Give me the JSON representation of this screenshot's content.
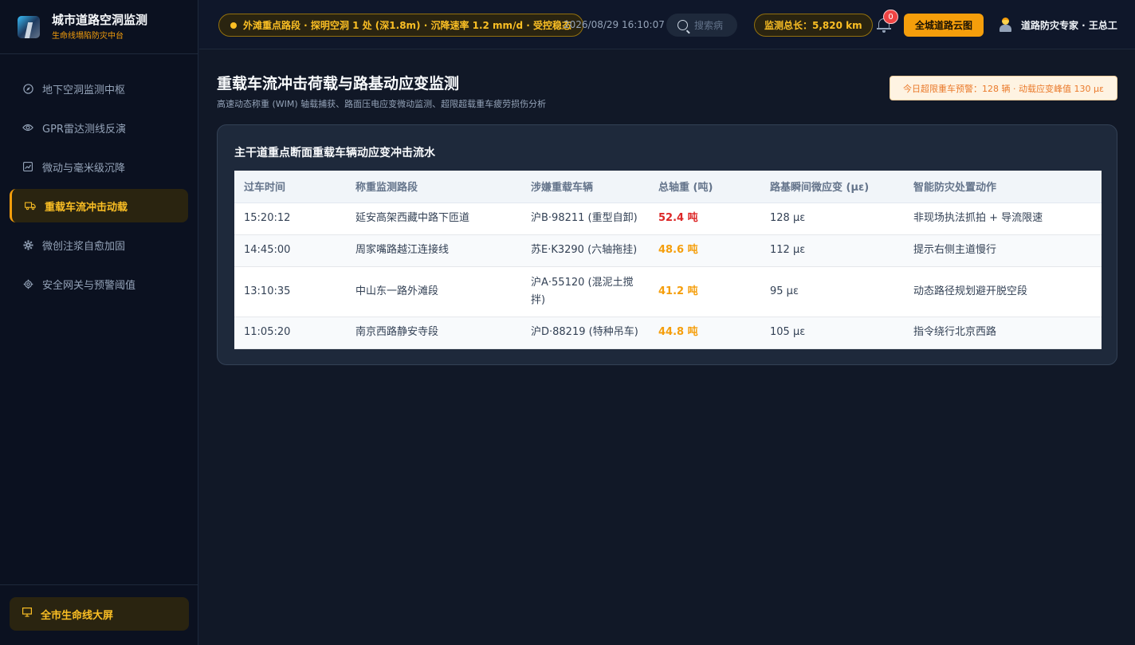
{
  "brand": {
    "title": "城市道路空洞监测",
    "subtitle": "生命线塌陷防灾中台"
  },
  "sidebar": {
    "items": [
      {
        "label": "地下空洞监测中枢",
        "icon": "compass-icon"
      },
      {
        "label": "GPR雷达测线反演",
        "icon": "eye-icon"
      },
      {
        "label": "微动与毫米级沉降",
        "icon": "chart-icon"
      },
      {
        "label": "重载车流冲击动载",
        "icon": "truck-icon",
        "active": true
      },
      {
        "label": "微创注浆自愈加固",
        "icon": "gear-icon"
      },
      {
        "label": "安全网关与预警阈值",
        "icon": "cog-icon"
      }
    ],
    "bottom_button": {
      "label": "全市生命线大屏",
      "icon": "screen-icon"
    }
  },
  "header": {
    "alert": "外滩重点路段 · 探明空洞 1 处 (深1.8m) · 沉降速率 1.2 mm/d · 受控稳态",
    "datetime": "2026/08/29 16:10:07",
    "search_placeholder": "搜索病",
    "monitor_length": "监测总长：5,820 km",
    "notification_count": "0",
    "cloud_button": "全城道路云图",
    "user": "道路防灾专家 · 王总工"
  },
  "main": {
    "title": "重载车流冲击荷载与路基动应变监测",
    "subtitle": "高速动态称重 (WIM) 轴载捕获、路面压电应变微动监测、超限超载重车疲劳损伤分析",
    "warning": "今日超限重车预警：128 辆 · 动载应变峰值 130 με",
    "card_title": "主干道重点断面重载车辆动应变冲击流水",
    "table": {
      "headers": [
        "过车时间",
        "称重监测路段",
        "涉嫌重载车辆",
        "总轴重 (吨)",
        "路基瞬间微应变 (με)",
        "智能防灾处置动作"
      ],
      "rows": [
        [
          "15:20:12",
          "延安高架西藏中路下匝道",
          "沪B·98211 (重型自卸)",
          "52.4 吨",
          "128 με",
          "非现场执法抓拍 + 导流限速"
        ],
        [
          "14:45:00",
          "周家嘴路越江连接线",
          "苏E·K3290 (六轴拖挂)",
          "48.6 吨",
          "112 με",
          "提示右侧主道慢行"
        ],
        [
          "13:10:35",
          "中山东一路外滩段",
          "沪A·55120 (混泥土搅拌)",
          "41.2 吨",
          "95 με",
          "动态路径规划避开脱空段"
        ],
        [
          "11:05:20",
          "南京西路静安寺段",
          "沪D·88219 (特种吊车)",
          "44.8 吨",
          "105 με",
          "指令绕行北京西路"
        ]
      ]
    }
  },
  "colors": {
    "accent": "#f59e0b",
    "danger": "#dc2626",
    "background": "#111827"
  }
}
